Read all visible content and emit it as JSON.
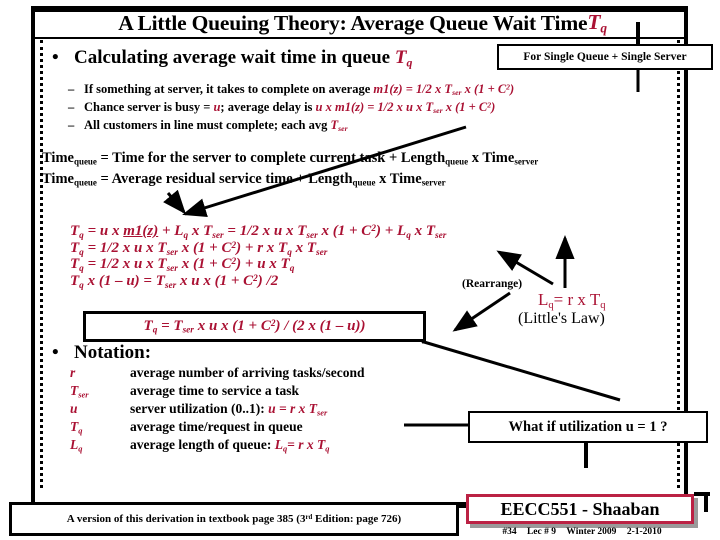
{
  "slide": {
    "title_main": "A Little Queuing Theory:   Average Queue Wait Time",
    "title_symbol": "T",
    "title_symbol_sub": "q",
    "accent_color": "#aa1133",
    "frame_color": "#000000"
  },
  "callouts": {
    "single_queue": "For Single Queue + Single Server",
    "utilization": "What if utilization u = 1 ?",
    "rearrange": "(Rearrange)"
  },
  "bullets": {
    "calculating": "Calculating average wait time in queue",
    "calculating_symbol": "T",
    "calculating_symbol_sub": "q",
    "notation": "Notation:"
  },
  "sub_bullets": [
    {
      "text": "If something at server, it takes to complete on average ",
      "formula_pre": "m1(z) = 1/2 x T",
      "formula_sub": "ser",
      "formula_post": " x (1 + C",
      "formula_sup": "2",
      "formula_end": ")"
    },
    {
      "text_a": "Chance server is busy = ",
      "sym_u": "u",
      "text_b": "; average delay is ",
      "formula_pre": "u x m1(z) = 1/2 x u x T",
      "formula_sub": "ser",
      "formula_post": " x (1 + C",
      "formula_sup": "2",
      "formula_end": ")"
    },
    {
      "text": "All customers in line must complete; each avg ",
      "sym": "T",
      "sym_sub": "ser"
    }
  ],
  "time_equations": [
    {
      "lhs": "Time",
      "lhs_sub": "queue",
      "eq": " =  Time for the server to complete current  task + Length",
      "mid_sub": "queue",
      "tail": " x Time",
      "tail_sub": "server"
    },
    {
      "lhs": "Time",
      "lhs_sub": "queue",
      "eq": " =            Average residual service time                      + Length",
      "mid_sub": "queue",
      "tail": " x Time",
      "tail_sub": "server"
    }
  ],
  "derivation": [
    "Tq = u x m1(z) +  Lq x Tser = 1/2 x u x  Tser x (1 + C2) + Lq x Tser",
    "Tq = 1/2 x u x Tser x (1 + C2) +  r x Tq x Tser",
    "Tq = 1/2 x u x Tser  x (1 + C2) +  u x Tq",
    "Tq x (1 – u)  = Tser  x  u  x (1 + C2) /2"
  ],
  "boxed_result": "Tq = Tser x  u  x  (1 + C2) / (2 x (1 – u))",
  "littles_law": {
    "equation_lhs": "L",
    "equation_lhs_sub": "q",
    "equation_rhs": "=     r    x    T",
    "equation_rhs_sub": "q",
    "label": "(Little's Law)"
  },
  "notation_rows": [
    {
      "symbol": "r",
      "symbol_sub": "",
      "desc": "average number of arriving tasks/second",
      "desc_formula": ""
    },
    {
      "symbol": "T",
      "symbol_sub": "ser",
      "desc": "average time to service a task",
      "desc_formula": ""
    },
    {
      "symbol": "u",
      "symbol_sub": "",
      "desc": "server utilization (0..1): ",
      "desc_formula": "u = r x Tser"
    },
    {
      "symbol": "T",
      "symbol_sub": "q",
      "desc": "average time/request in queue",
      "desc_formula": ""
    },
    {
      "symbol": "L",
      "symbol_sub": "q",
      "desc": "average length of queue:    ",
      "desc_formula": "Lq= r x Tq"
    }
  ],
  "footer": {
    "note": "A version of this derivation in textbook page 385 (3rd Edition: page 726)",
    "note_sup": "rd",
    "signature": "EECC551 - Shaaban",
    "meta_slide": "#34",
    "meta_lecture": "Lec # 9",
    "meta_term": "Winter 2009",
    "meta_date": "2-1-2010"
  }
}
